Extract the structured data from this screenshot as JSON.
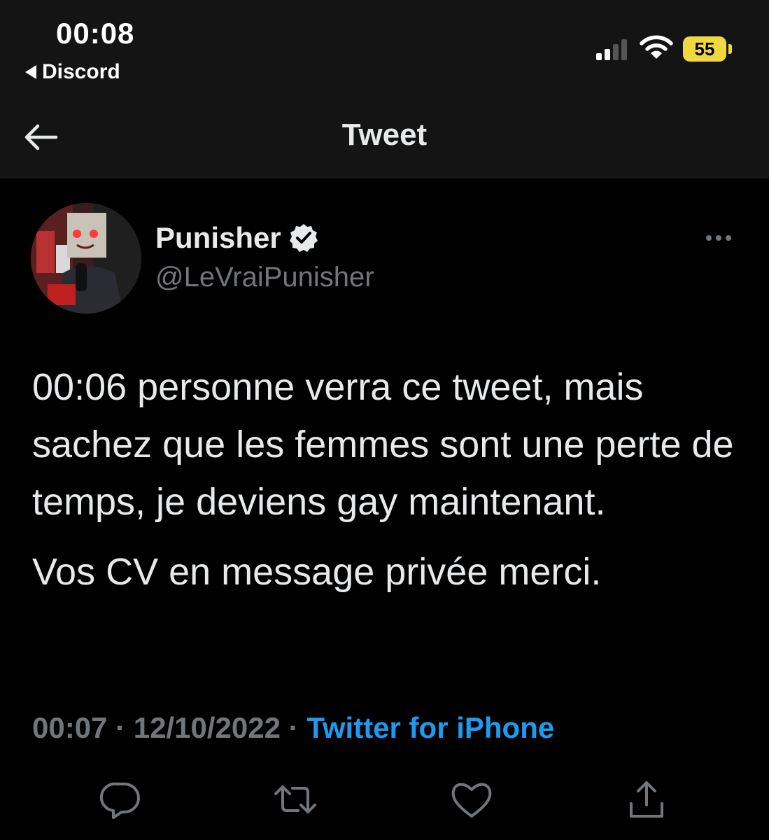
{
  "status_bar": {
    "time": "00:08",
    "back_app": "Discord",
    "battery": "55",
    "battery_color": "#f1d83e"
  },
  "nav": {
    "back_icon": "arrow-left-icon",
    "title": "Tweet"
  },
  "tweet": {
    "author": {
      "display_name": "Punisher",
      "handle": "@LeVraiPunisher",
      "verified": true,
      "verified_icon": "verified-badge-icon"
    },
    "more_icon": "more-horizontal-icon",
    "text_paragraphs": [
      "00:06 personne verra ce tweet, mais sachez que les femmes sont une perte de temps, je deviens gay maintenant.",
      "Vos CV en message privée merci."
    ],
    "time": "00:07",
    "separator": "·",
    "date": "12/10/2022",
    "source": "Twitter for iPhone",
    "source_color": "#1d9bf0"
  },
  "actions": [
    {
      "icon": "reply-icon"
    },
    {
      "icon": "retweet-icon"
    },
    {
      "icon": "like-icon"
    },
    {
      "icon": "share-icon"
    }
  ],
  "colors": {
    "background": "#000000",
    "header_background": "#141414",
    "text_primary": "#e7e9ea",
    "text_secondary": "#71767b"
  }
}
